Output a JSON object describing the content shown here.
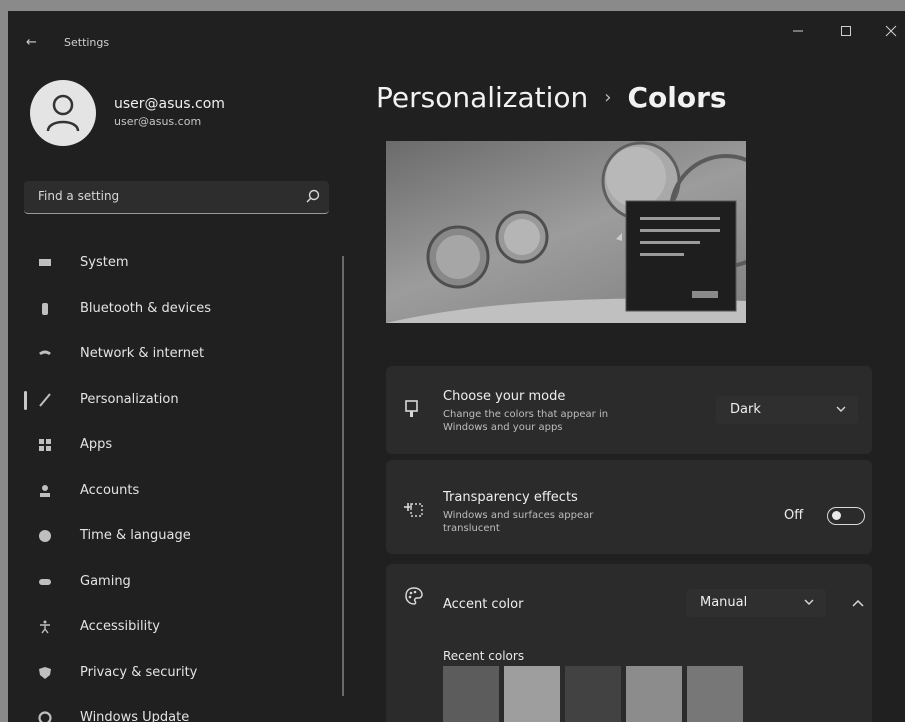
{
  "window": {
    "title": "Settings",
    "back_icon": "back-arrow-icon",
    "min_icon": "minimize-icon",
    "max_icon": "maximize-icon",
    "close_icon": "close-icon"
  },
  "user": {
    "name": "user@asus.com",
    "email": "user@asus.com"
  },
  "search": {
    "placeholder": "Find a setting"
  },
  "nav": [
    {
      "label": "System",
      "icon": "system-icon"
    },
    {
      "label": "Bluetooth & devices",
      "icon": "bluetooth-icon"
    },
    {
      "label": "Network & internet",
      "icon": "network-icon"
    },
    {
      "label": "Personalization",
      "icon": "brush-icon",
      "active": true
    },
    {
      "label": "Apps",
      "icon": "apps-icon"
    },
    {
      "label": "Accounts",
      "icon": "accounts-icon"
    },
    {
      "label": "Time & language",
      "icon": "globe-icon"
    },
    {
      "label": "Gaming",
      "icon": "gamepad-icon"
    },
    {
      "label": "Accessibility",
      "icon": "accessibility-icon"
    },
    {
      "label": "Privacy & security",
      "icon": "shield-icon"
    },
    {
      "label": "Windows Update",
      "icon": "update-icon"
    }
  ],
  "breadcrumb": {
    "parent": "Personalization",
    "separator": "›",
    "current": "Colors"
  },
  "mode": {
    "title": "Choose your mode",
    "desc": "Change the colors that appear in Windows and your apps",
    "value": "Dark"
  },
  "transparency": {
    "title": "Transparency effects",
    "desc": "Windows and surfaces appear translucent",
    "state": "Off"
  },
  "accent": {
    "title": "Accent color",
    "value": "Manual"
  },
  "recent_colors": {
    "label": "Recent colors",
    "swatches": [
      "#5c5c5c",
      "#9e9e9e",
      "#424242",
      "#8c8c8c",
      "#777777"
    ]
  }
}
